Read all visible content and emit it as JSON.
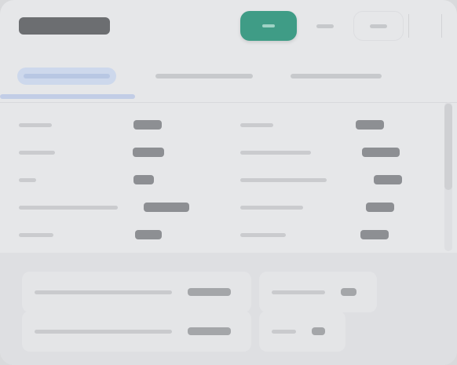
{
  "header": {
    "title": "",
    "primary_button": "",
    "secondary_button_1": "",
    "secondary_button_2": ""
  },
  "tabs": [
    {
      "label": "",
      "active": true
    },
    {
      "label": "",
      "active": false
    },
    {
      "label": "",
      "active": false
    }
  ],
  "rows_left": [
    {
      "label": "",
      "value": ""
    },
    {
      "label": "",
      "value": ""
    },
    {
      "label": "",
      "value": ""
    },
    {
      "label": "",
      "value": ""
    },
    {
      "label": "",
      "value": ""
    }
  ],
  "rows_right": [
    {
      "label": "",
      "value": ""
    },
    {
      "label": "",
      "value": ""
    },
    {
      "label": "",
      "value": ""
    },
    {
      "label": "",
      "value": ""
    },
    {
      "label": "",
      "value": ""
    }
  ],
  "footer_cards": [
    {
      "label": "",
      "value": ""
    },
    {
      "label": "",
      "value": ""
    },
    {
      "label": "",
      "value": ""
    },
    {
      "label": "",
      "value": ""
    }
  ],
  "colors": {
    "accent": "#3f9c86",
    "active_tab": "#cdd8ec",
    "background": "#e6e7e9"
  }
}
